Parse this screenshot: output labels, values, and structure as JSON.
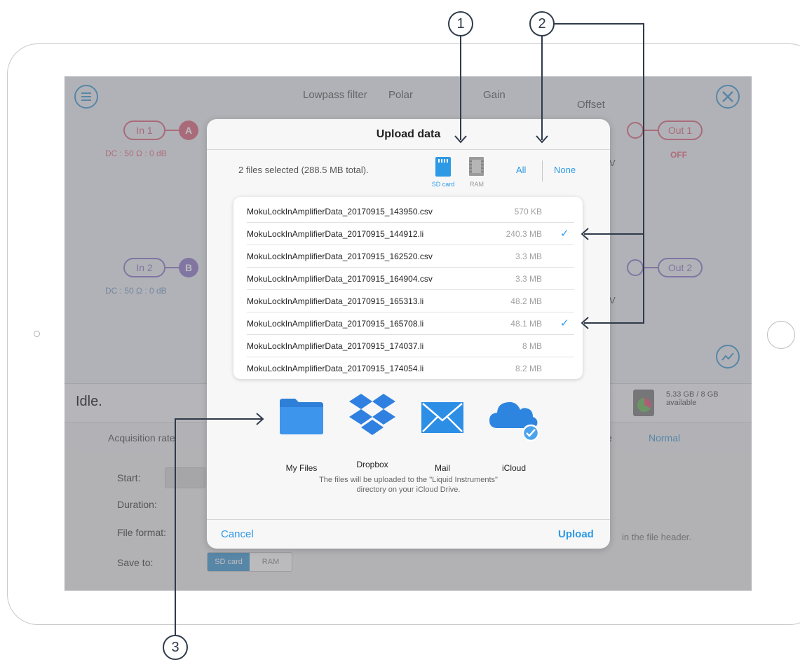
{
  "app": {
    "blocks": {
      "lowpass": "Lowpass filter",
      "polar": "Polar",
      "gain": "Gain",
      "offset": "Offset"
    },
    "in1": "In 1",
    "in2": "In 2",
    "chan_a": "A",
    "chan_b": "B",
    "in1_info": "DC : 50 Ω : 0 dB",
    "in2_info": "DC : 50 Ω : 0 dB",
    "out1": "Out 1",
    "out2": "Out 2",
    "out1_state": "OFF",
    "v1": "V",
    "v2": "V",
    "status": "Idle.",
    "storage": "5.33 GB / 8 GB\navailable",
    "tab_acq": "Acquisition rate",
    "tab_mode_end": "e",
    "tab_normal": "Normal",
    "form": {
      "start": "Start:",
      "duration": "Duration:",
      "format": "File format:",
      "save_to": "Save to:",
      "sd_card": "SD card",
      "ram": "RAM",
      "header_note": "in the file header."
    }
  },
  "dialog": {
    "title": "Upload data",
    "selection_info": "2 files selected (288.5 MB total).",
    "storage_sd": "SD card",
    "storage_ram": "RAM",
    "select_all": "All",
    "select_none": "None",
    "files": [
      {
        "name": "MokuLockInAmplifierData_20170915_143950.csv",
        "size": "570 KB",
        "check": ""
      },
      {
        "name": "MokuLockInAmplifierData_20170915_144912.li",
        "size": "240.3 MB",
        "check": "✓"
      },
      {
        "name": "MokuLockInAmplifierData_20170915_162520.csv",
        "size": "3.3 MB",
        "check": ""
      },
      {
        "name": "MokuLockInAmplifierData_20170915_164904.csv",
        "size": "3.3 MB",
        "check": ""
      },
      {
        "name": "MokuLockInAmplifierData_20170915_165313.li",
        "size": "48.2 MB",
        "check": ""
      },
      {
        "name": "MokuLockInAmplifierData_20170915_165708.li",
        "size": "48.1 MB",
        "check": "✓"
      },
      {
        "name": "MokuLockInAmplifierData_20170915_174037.li",
        "size": "8 MB",
        "check": ""
      },
      {
        "name": "MokuLockInAmplifierData_20170915_174054.li",
        "size": "8.2 MB",
        "check": ""
      }
    ],
    "destinations": {
      "my_files": "My Files",
      "dropbox": "Dropbox",
      "mail": "Mail",
      "icloud": "iCloud"
    },
    "note": "The files will be uploaded to the \"Liquid Instruments\"\ndirectory on your iCloud Drive.",
    "cancel": "Cancel",
    "upload": "Upload"
  },
  "callouts": {
    "c1": "1",
    "c2": "2",
    "c3": "3"
  },
  "colors": {
    "accent": "#2e9ae6",
    "callout": "#2f3a4a",
    "overlay": "rgba(85,85,92,0.40)"
  }
}
